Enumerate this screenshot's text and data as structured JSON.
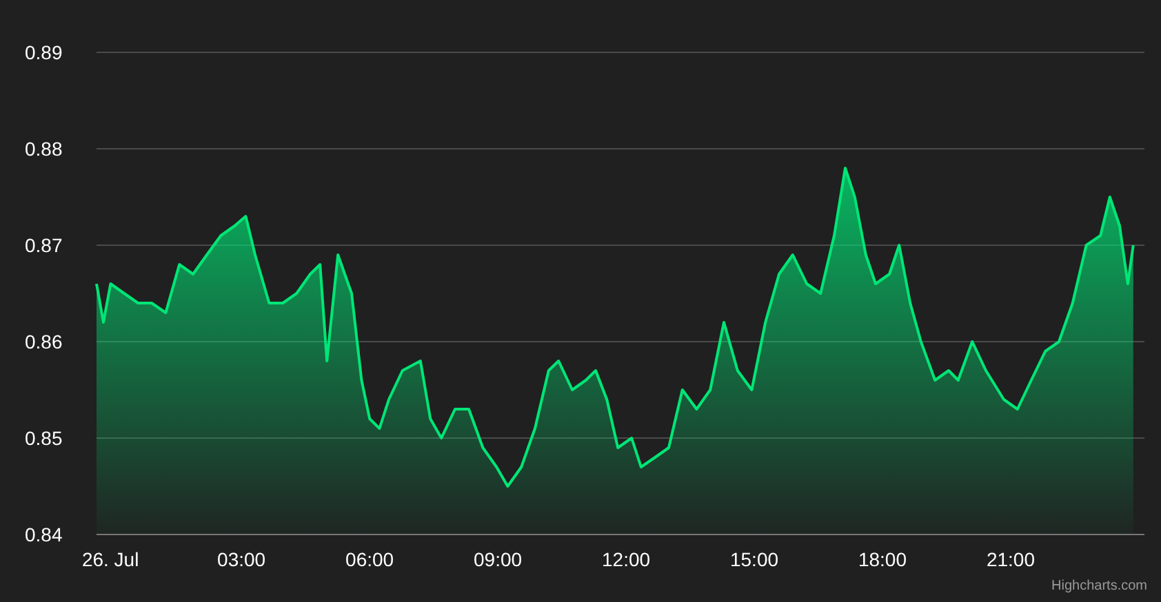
{
  "chart_data": {
    "type": "area",
    "grid": true,
    "xlim": [
      -0.39,
      24.13
    ],
    "ylim": [
      0.84,
      0.89
    ],
    "xticks": [
      {
        "value": 0,
        "label": "26. Jul"
      },
      {
        "value": 3,
        "label": "03:00"
      },
      {
        "value": 6,
        "label": "06:00"
      },
      {
        "value": 9,
        "label": "09:00"
      },
      {
        "value": 12,
        "label": "12:00"
      },
      {
        "value": 15,
        "label": "15:00"
      },
      {
        "value": 18,
        "label": "18:00"
      },
      {
        "value": 21,
        "label": "21:00"
      }
    ],
    "yticks": [
      {
        "value": 0.84,
        "label": "0.84"
      },
      {
        "value": 0.85,
        "label": "0.85"
      },
      {
        "value": 0.86,
        "label": "0.86"
      },
      {
        "value": 0.87,
        "label": "0.87"
      },
      {
        "value": 0.88,
        "label": "0.88"
      },
      {
        "value": 0.89,
        "label": "0.89"
      }
    ],
    "x": [
      -0.39,
      -0.23,
      -0.06,
      0.26,
      0.58,
      0.9,
      1.23,
      1.55,
      1.87,
      2.19,
      2.52,
      2.84,
      3.1,
      3.32,
      3.65,
      3.97,
      4.29,
      4.61,
      4.84,
      5.0,
      5.26,
      5.58,
      5.81,
      6.0,
      6.23,
      6.45,
      6.77,
      7.19,
      7.42,
      7.68,
      8.0,
      8.32,
      8.65,
      8.97,
      9.23,
      9.55,
      9.87,
      10.19,
      10.42,
      10.74,
      11.06,
      11.29,
      11.55,
      11.81,
      12.13,
      12.35,
      12.68,
      13.0,
      13.32,
      13.65,
      13.97,
      14.29,
      14.61,
      14.94,
      15.26,
      15.58,
      15.9,
      16.23,
      16.55,
      16.87,
      17.13,
      17.35,
      17.61,
      17.84,
      18.16,
      18.39,
      18.65,
      18.9,
      19.23,
      19.55,
      19.77,
      20.1,
      20.42,
      20.84,
      21.16,
      21.48,
      21.81,
      22.13,
      22.45,
      22.77,
      23.1,
      23.32,
      23.55,
      23.74,
      23.87
    ],
    "series": [
      {
        "color": "#00e676",
        "values": [
          0.866,
          0.862,
          0.866,
          0.865,
          0.864,
          0.864,
          0.863,
          0.868,
          0.867,
          0.869,
          0.871,
          0.872,
          0.873,
          0.869,
          0.864,
          0.864,
          0.865,
          0.867,
          0.868,
          0.858,
          0.869,
          0.865,
          0.856,
          0.852,
          0.851,
          0.854,
          0.857,
          0.858,
          0.852,
          0.85,
          0.853,
          0.853,
          0.849,
          0.847,
          0.845,
          0.847,
          0.851,
          0.857,
          0.858,
          0.855,
          0.856,
          0.857,
          0.854,
          0.849,
          0.85,
          0.847,
          0.848,
          0.849,
          0.855,
          0.853,
          0.855,
          0.862,
          0.857,
          0.855,
          0.862,
          0.867,
          0.869,
          0.866,
          0.865,
          0.871,
          0.878,
          0.875,
          0.869,
          0.866,
          0.867,
          0.87,
          0.864,
          0.86,
          0.856,
          0.857,
          0.856,
          0.86,
          0.857,
          0.854,
          0.853,
          0.856,
          0.859,
          0.86,
          0.864,
          0.87,
          0.871,
          0.875,
          0.872,
          0.866,
          0.87
        ]
      }
    ]
  },
  "credit": "Highcharts.com"
}
